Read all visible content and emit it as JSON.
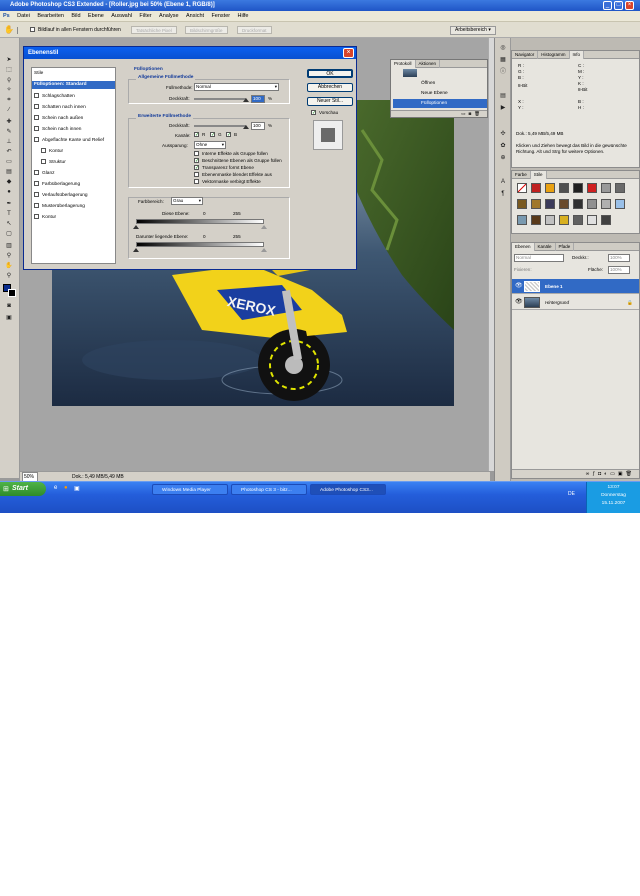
{
  "window": {
    "title": "Adobe Photoshop CS3 Extended - [Roller.jpg bei 50% (Ebene 1, RGB/8)]"
  },
  "menu": [
    "Datei",
    "Bearbeiten",
    "Bild",
    "Ebene",
    "Auswahl",
    "Filter",
    "Analyse",
    "Ansicht",
    "Fenster",
    "Hilfe"
  ],
  "options": {
    "checkbox_label": "Bildlauf in allen Fenstern durchführen",
    "buttons": [
      "Tatsächliche Pixel",
      "Bildschirmgröße",
      "Druckformat"
    ],
    "workspace": "Arbeitsbereich"
  },
  "status": {
    "zoom": "50%",
    "doc": "Dok.: 5,49 MB/5,49 MB"
  },
  "dialog": {
    "title": "Ebenenstil",
    "list_header": "Stile",
    "list_selected": "Fülloptionen: Standard",
    "list_items": [
      "Schlagschatten",
      "Schatten nach innen",
      "Schein nach außen",
      "Schein nach innen",
      "Abgeflachte Kante und Relief",
      "Kontur",
      "Struktur",
      "Glanz",
      "Farbüberlagerung",
      "Verlaufsüberlagerung",
      "Musterüberlagerung",
      "Kontur"
    ],
    "section_fill": "Fülloptionen",
    "group_general": "Allgemeine Füllmethode",
    "blend_mode_label": "Füllmethode:",
    "blend_mode_value": "Normal",
    "opacity_label": "Deckkraft:",
    "opacity_value": "100",
    "percent": "%",
    "group_advanced": "Erweiterte Füllmethode",
    "fill_opacity_label": "Deckkraft:",
    "fill_opacity_value": "100",
    "channels_label": "Kanäle:",
    "channels": [
      "R",
      "G",
      "B"
    ],
    "knockout_label": "Aussparung:",
    "knockout_value": "Ohne",
    "options_checks": [
      {
        "label": "Interne Effekte als Gruppe füllen",
        "checked": false
      },
      {
        "label": "Beschnittene Ebenen als Gruppe füllen",
        "checked": true
      },
      {
        "label": "Transparenz formt Ebene",
        "checked": true
      },
      {
        "label": "Ebenenmaske blendet Effekte aus",
        "checked": false
      },
      {
        "label": "Vektormaske verbirgt Effekte",
        "checked": false
      }
    ],
    "blend_if_label": "Farbbereich:",
    "blend_if_value": "Grau",
    "this_layer_label": "Diese Ebene:",
    "this_layer_min": "0",
    "this_layer_max": "255",
    "under_layer_label": "Darunter liegende Ebene:",
    "under_layer_min": "0",
    "under_layer_max": "255",
    "btn_ok": "OK",
    "btn_cancel": "Abbrechen",
    "btn_new_style": "Neuer Stil...",
    "preview_label": "Vorschau"
  },
  "history": {
    "tabs": [
      "Protokoll",
      "Aktionen"
    ],
    "items": [
      "Öffnen",
      "Neue Ebene",
      "Fülloptionen"
    ],
    "selected": "Fülloptionen"
  },
  "navigator": {
    "tabs": [
      "Navigator",
      "Histogramm",
      "Info"
    ],
    "labels": [
      "R :",
      "G :",
      "B :",
      "8-Bit",
      "C :",
      "M :",
      "Y :",
      "K :",
      "8-Bit",
      "X :",
      "Y :",
      "B :",
      "H :"
    ],
    "doc": "Dok.: 5,49 MB/5,49 MB",
    "hint": "Klicken und Ziehen bewegt das Bild in die gewünschte Richtung. Alt und Strg für weitere Optionen."
  },
  "styles": {
    "tabs": [
      "Farbe",
      "Stile"
    ]
  },
  "layers": {
    "tabs": [
      "Ebenen",
      "Kanäle",
      "Pfade"
    ],
    "mode": "Normal",
    "opacity_label": "Deckkr.:",
    "opacity_value": "100%",
    "lock_label": "Fixieren:",
    "fill_label": "Fläche:",
    "fill_value": "100%",
    "rows": [
      "Ebene 1",
      "Hintergrund"
    ]
  },
  "taskbar": {
    "start": "Start",
    "tasks": [
      "Windows Media Player",
      "Photoshop CS 3 - bitz...",
      "Adobe Photoshop CS3..."
    ],
    "time": "13:07",
    "day": "Donnerstag",
    "date": "15.11.2007",
    "lang": "DE"
  },
  "colors": {
    "titlebar": "#1f55c6",
    "selection": "#316ac5",
    "taskbar": "#245edb",
    "start": "#3aa23a"
  }
}
